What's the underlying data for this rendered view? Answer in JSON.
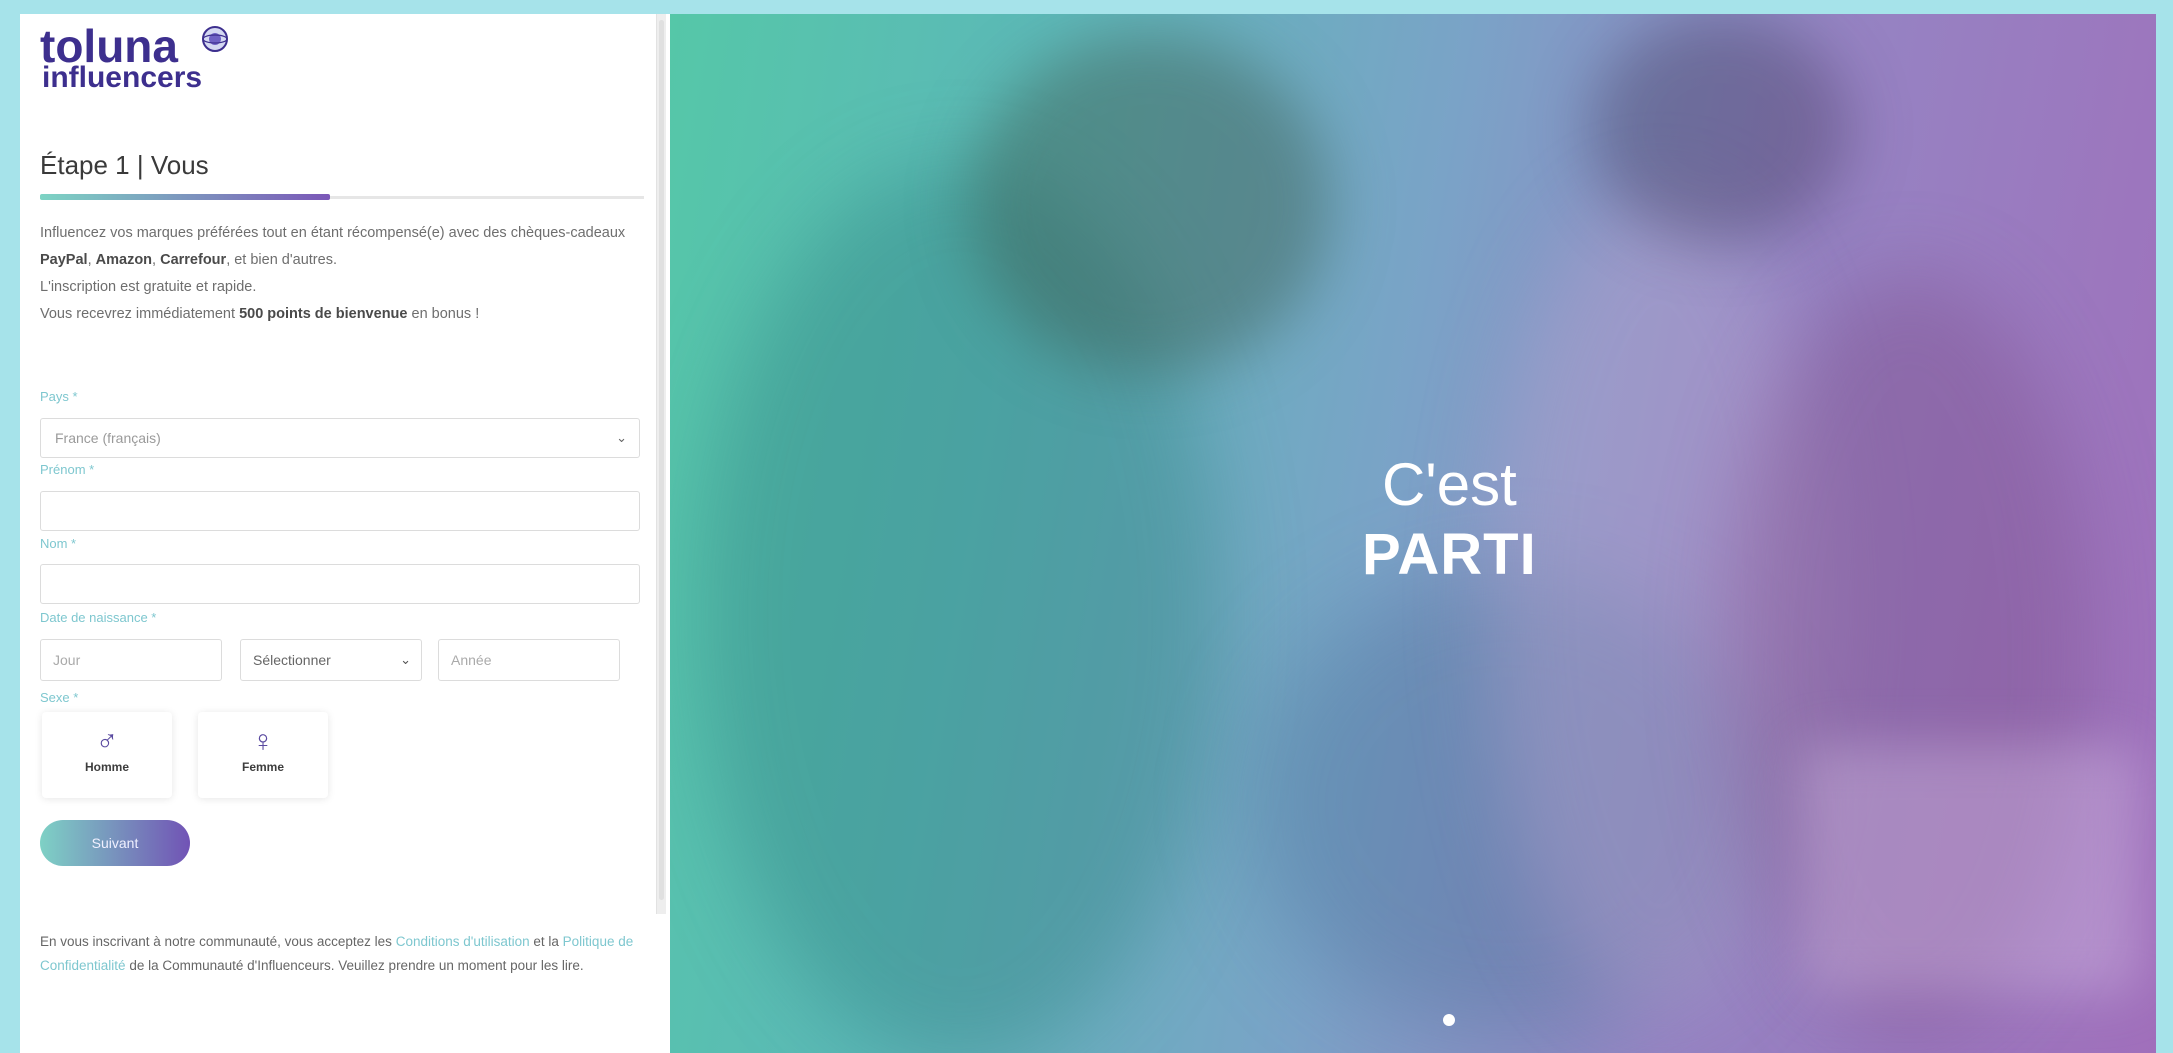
{
  "logo": {
    "line1": "toluna",
    "line2": "influencers"
  },
  "step": {
    "title": "Étape 1 | Vous",
    "progress_fraction": 0.48
  },
  "intro": {
    "line1_prefix": "Influencez vos marques préférées tout en étant récompensé(e) avec des chèques-cadeaux",
    "brand1": "PayPal",
    "brand2": "Amazon",
    "brand3": "Carrefour",
    "line1_suffix": ", et bien d'autres.",
    "line2": "L'inscription est gratuite et rapide.",
    "line3_prefix": "Vous recevrez immédiatement",
    "line3_bold": "500 points de bienvenue",
    "line3_suffix": "en bonus !"
  },
  "form": {
    "country_label": "Pays *",
    "country_value": "France (français)",
    "firstname_label": "Prénom *",
    "firstname_value": "",
    "lastname_label": "Nom *",
    "lastname_value": "",
    "birthdate_label": "Date de naissance *",
    "day_placeholder": "Jour",
    "month_value": "Sélectionner",
    "year_placeholder": "Année",
    "sex_label": "Sexe *",
    "male_label": "Homme",
    "female_label": "Femme",
    "next_button": "Suivant"
  },
  "legal": {
    "prefix": "En vous inscrivant à notre communauté, vous acceptez les",
    "link1": "Conditions d'utilisation",
    "mid": "et la",
    "link2": "Politique de Confidentialité",
    "suffix": "de la Communauté d'Influenceurs. Veuillez prendre un moment pour les lire."
  },
  "hero": {
    "line1": "C'est",
    "line2": "PARTI",
    "carousel_current": 1,
    "carousel_total": 1
  },
  "colors": {
    "brand": "#3d2f8e",
    "accent_teal": "#7ec7cf",
    "gradient_start": "#55c7a8",
    "gradient_end": "#a06fbb"
  },
  "icons": {
    "male": "male-symbol-icon",
    "female": "female-symbol-icon",
    "dropdown": "chevron-down-icon",
    "logo_mark": "globe-logo-icon"
  }
}
